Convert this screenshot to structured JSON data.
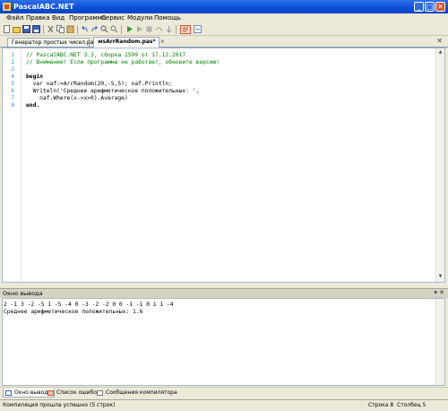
{
  "window": {
    "title": "PascalABC.NET",
    "btn_minimize": "_",
    "btn_maximize": "□",
    "btn_close": "✕"
  },
  "menu": {
    "items": [
      {
        "label": "Файл"
      },
      {
        "label": "Правка"
      },
      {
        "label": "Вид"
      },
      {
        "label": "Программа"
      },
      {
        "label": "Сервис"
      },
      {
        "label": "Модули"
      },
      {
        "label": "Помощь"
      }
    ]
  },
  "toolbar": {
    "icons": [
      "new-file-icon",
      "open-folder-icon",
      "save-icon",
      "save-all-icon",
      "cut-icon",
      "copy-icon",
      "paste-icon",
      "undo-icon",
      "redo-icon",
      "find-icon",
      "replace-icon",
      "run-icon",
      "debug-run-icon",
      "stop-icon",
      "step-over-icon",
      "step-into-icon",
      "format-icon",
      "auto-complete-icon"
    ]
  },
  "tabs": {
    "items": [
      {
        "label": "Генератор простых чисел.pas",
        "active": false
      },
      {
        "label": "wsArrRandom.pas*",
        "active": true
      }
    ],
    "close_glyph": "×"
  },
  "editor": {
    "line_numbers": [
      "1",
      "2",
      "3",
      "4",
      "5",
      "6",
      "7",
      "8"
    ],
    "lines": [
      {
        "text": "// PascalABC.NET 3.3, сборка 1599 от 17.12.2017"
      },
      {
        "text": "// Внимание! Если программа не работает, обновите версию!"
      },
      {
        "text": ""
      },
      {
        "text": "begin"
      },
      {
        "text": "  var naf:=ArrRandom(20,-5,5); naf.Println;"
      },
      {
        "text": "  Writeln('Среднее арифметическое положительных: ',"
      },
      {
        "text": "    naf.Where(x->x>0).Average)"
      },
      {
        "text": "end."
      }
    ]
  },
  "output_panel": {
    "title": "Окно вывода",
    "lines": [
      "2 -1 3 -2 -5 1 -5 -4 0 -3 -2 -2 0 0 -1 -1 0 1 1 -4",
      "Среднее арифметическое положительных: 1.6"
    ]
  },
  "bottom_tabs": {
    "items": [
      {
        "label": "Окно вывода",
        "active": true
      },
      {
        "label": "Список ошибок",
        "active": false
      },
      {
        "label": "Сообщения компилятора",
        "active": false
      }
    ]
  },
  "status": {
    "message": "Компиляция прошла успешно (5 строк)",
    "row_label": "Строка 8",
    "col_label": "Столбец 5"
  },
  "colors": {
    "titlebar": "#0a4fd6",
    "comment": "#008000",
    "string": "#0000ff",
    "line_number": "#2b91af",
    "chrome": "#ece9d8"
  }
}
